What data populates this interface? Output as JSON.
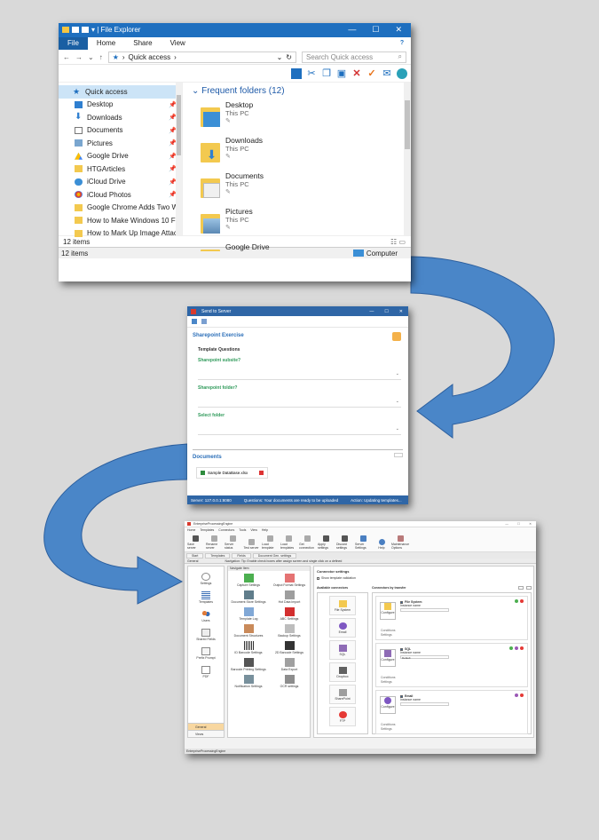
{
  "colors": {
    "background": "#d9d9d9",
    "arrow": "#4a86c8",
    "arrow_dark": "#2c5f9e",
    "explorer_blue": "#1e6fbf"
  },
  "explorer": {
    "title": "File Explorer",
    "ribbon_tabs": [
      "File",
      "Home",
      "Share",
      "View"
    ],
    "address": "Quick access",
    "search_placeholder": "Search Quick access",
    "nav_items": [
      {
        "label": "Quick access",
        "icon": "star-icon",
        "selected": true
      },
      {
        "label": "Desktop",
        "icon": "desktop-icon",
        "pinned": true
      },
      {
        "label": "Downloads",
        "icon": "download-icon",
        "pinned": true
      },
      {
        "label": "Documents",
        "icon": "documents-icon",
        "pinned": true
      },
      {
        "label": "Pictures",
        "icon": "pictures-icon",
        "pinned": true
      },
      {
        "label": "Google Drive",
        "icon": "google-drive-icon",
        "pinned": true
      },
      {
        "label": "HTGArticles",
        "icon": "folder-icon",
        "pinned": true
      },
      {
        "label": "iCloud Drive",
        "icon": "icloud-icon",
        "pinned": true
      },
      {
        "label": "iCloud Photos",
        "icon": "icloud-photos-icon",
        "pinned": true
      },
      {
        "label": "Google Chrome Adds Two Way",
        "icon": "folder-icon"
      },
      {
        "label": "How to Make Windows 10 File E",
        "icon": "folder-icon"
      },
      {
        "label": "How to Mark Up Image Attachr",
        "icon": "folder-icon"
      }
    ],
    "section_header": "Frequent folders (12)",
    "folders": [
      {
        "name": "Desktop",
        "location": "This PC",
        "color": "#3b8fd6"
      },
      {
        "name": "Downloads",
        "location": "This PC",
        "color": "#2f7fd0"
      },
      {
        "name": "Documents",
        "location": "This PC",
        "color": "#e8e8e8"
      },
      {
        "name": "Pictures",
        "location": "This PC",
        "color": "#8fb6d8"
      },
      {
        "name": "Google Drive",
        "location": "",
        "color": "#f3c94f"
      }
    ],
    "status_items": "12 items",
    "status_bottom": "12 items",
    "status_computer": "Computer"
  },
  "send_to_server": {
    "title": "Send to Server",
    "section_title": "Sharepoint Exercise",
    "subsection": "Template Questions",
    "questions": [
      "Sharepoint subsite?",
      "Sharepoint folder?",
      "Select folder"
    ],
    "documents_header": "Documents",
    "document_file": "Sample DataBase.xlsx",
    "status_server": "Server: 127.0.0.1:8080",
    "status_questions": "Questions: Your documents are ready to be uploaded",
    "status_action": "Action: Updating templates..."
  },
  "connector_app": {
    "title": "EnterpriseProcessingEngine",
    "menu": [
      "Home",
      "Templates",
      "Connectors",
      "Tools",
      "View",
      "Help"
    ],
    "ribbon": [
      {
        "label": "Save server",
        "style": "dark"
      },
      {
        "label": "Rename server",
        "style": "dim"
      },
      {
        "label": "Server status",
        "style": "dim"
      },
      {
        "label": "Test server",
        "style": "dim"
      },
      {
        "label": "Load template",
        "style": "dim"
      },
      {
        "label": "Load templates",
        "style": "dim"
      },
      {
        "label": "Get connection",
        "style": "dim"
      },
      {
        "label": "Apply settings",
        "style": "dark"
      },
      {
        "label": "Discard settings",
        "style": "dark"
      },
      {
        "label": "Server Settings",
        "style": "blue"
      },
      {
        "label": "Help",
        "style": "blue"
      },
      {
        "label": "Maintenance Options",
        "style": "mix"
      }
    ],
    "tabs": [
      "Start",
      "Templates",
      "Fields",
      "Document Gen. settings"
    ],
    "left_header": "General",
    "breadcrumb": "Navigation: Tip: Enable check boxes after assign screen and single click on a defined",
    "left_items": [
      {
        "label": "Settings",
        "icon": "settings-icon"
      },
      {
        "label": "Templates",
        "icon": "templates-icon"
      },
      {
        "label": "Users",
        "icon": "users-icon"
      },
      {
        "label": "Shared Fields",
        "icon": "shared-fields-icon"
      },
      {
        "label": "Prefix Prompt",
        "icon": "prefix-icon"
      },
      {
        "label": "PDF",
        "icon": "pdf-icon"
      }
    ],
    "left_bottom": [
      "General",
      "Views"
    ],
    "mid_title": "Navigate Item",
    "mid_items": [
      "Capture Settings",
      "Output Format Settings",
      "Document Store Settings",
      "Hot Data Import",
      "Template Log",
      "ABC Settings",
      "Document Structures",
      "Backup Settings",
      "ID Barcode Settings",
      "2D Barcode Settings",
      "Barcode Printing Settings",
      "Data Export",
      "Notification Settings",
      "OCR settings"
    ],
    "right_title": "Connector settings",
    "show_template_checkbox": "Show template validation",
    "available_header": "Available connectors",
    "connectors_header": "Connectors by transfer",
    "available": [
      "File System",
      "Email",
      "SQL",
      "Dropbox",
      "SharePoint",
      "FTP"
    ],
    "connectors": [
      {
        "name": "File System",
        "instance_label": "Instance name",
        "instance_value": "",
        "configure": "Configure",
        "conditions": "Conditions",
        "settings": "Settings"
      },
      {
        "name": "SQL",
        "instance_label": "Instance name",
        "instance_value": "Default",
        "configure": "Configure",
        "conditions": "Conditions",
        "settings": "Settings"
      },
      {
        "name": "Email",
        "instance_label": "Instance name",
        "instance_value": "",
        "configure": "Configure",
        "conditions": "Conditions",
        "settings": "Settings"
      }
    ],
    "status": "EnterpriseProcessingEngine"
  }
}
